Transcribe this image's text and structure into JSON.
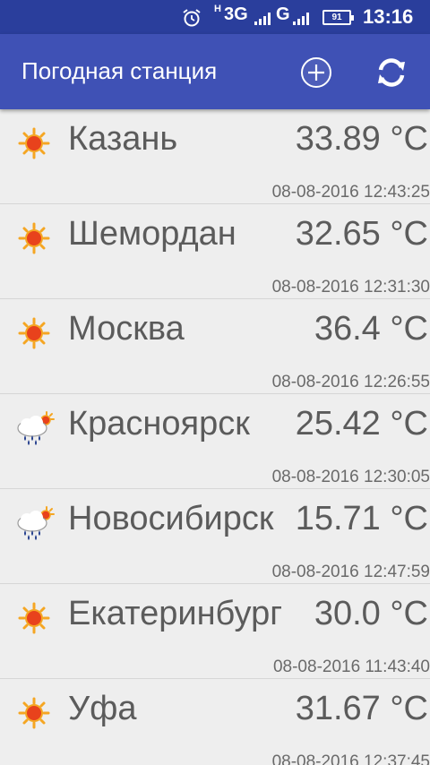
{
  "status_bar": {
    "network_type_small": "H",
    "network_type": "3G",
    "network_type_2": "G",
    "battery": "91",
    "clock": "13:16"
  },
  "app_bar": {
    "title": "Погодная станция",
    "icons": [
      "add-circle-icon",
      "refresh-icon"
    ]
  },
  "colors": {
    "status_bar": "#2a3e9c",
    "app_bar": "#3f51b5",
    "background": "#eeeeee",
    "text": "#5b5b5b"
  },
  "cities": [
    {
      "name": "Казань",
      "temp": "33.89 °C",
      "updated": "08-08-2016 12:43:25",
      "icon": "sun-icon"
    },
    {
      "name": "Шемордан",
      "temp": "32.65 °C",
      "updated": "08-08-2016 12:31:30",
      "icon": "sun-icon"
    },
    {
      "name": "Москва",
      "temp": "36.4 °C",
      "updated": "08-08-2016 12:26:55",
      "icon": "sun-icon"
    },
    {
      "name": "Красноярск",
      "temp": "25.42 °C",
      "updated": "08-08-2016 12:30:05",
      "icon": "rain-cloud-sun-icon"
    },
    {
      "name": "Новосибирск",
      "temp": "15.71 °C",
      "updated": "08-08-2016 12:47:59",
      "icon": "rain-cloud-sun-icon"
    },
    {
      "name": "Екатеринбург",
      "temp": "30.0 °C",
      "updated": "08-08-2016 11:43:40",
      "icon": "sun-icon"
    },
    {
      "name": "Уфа",
      "temp": "31.67 °C",
      "updated": "08-08-2016 12:37:45",
      "icon": "sun-icon"
    }
  ]
}
